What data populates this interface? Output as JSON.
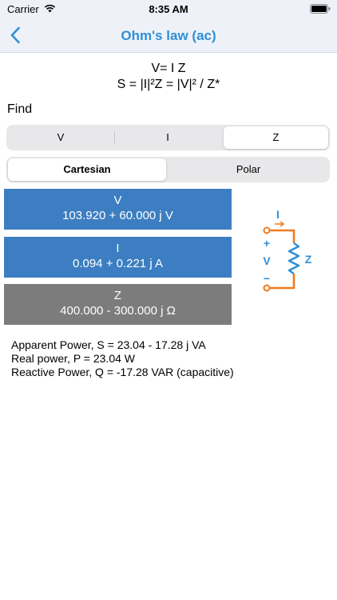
{
  "status_bar": {
    "carrier": "Carrier",
    "time": "8:35 AM"
  },
  "nav": {
    "title": "Ohm's law (ac)"
  },
  "formulas": {
    "line1": "V= I Z",
    "line2": "S = |I|²Z = |V|² / Z*"
  },
  "find": {
    "label": "Find",
    "options": [
      "V",
      "I",
      "Z"
    ],
    "selected": "Z"
  },
  "coordinates": {
    "options": [
      "Cartesian",
      "Polar"
    ],
    "selected": "Cartesian"
  },
  "values": {
    "v": {
      "label": "V",
      "value": "103.920 + 60.000 j V"
    },
    "i": {
      "label": "I",
      "value": "0.094 + 0.221 j A"
    },
    "z": {
      "label": "Z",
      "value": "400.000 - 300.000 j Ω"
    }
  },
  "circuit": {
    "current_label": "I",
    "voltage_label": "V",
    "plus": "+",
    "minus": "−",
    "impedance_label": "Z"
  },
  "power": {
    "apparent": "Apparent Power, S = 23.04 - 17.28 j VA",
    "real": "Real power, P = 23.04 W",
    "reactive": "Reactive Power, Q = -17.28 VAR (capacitive)"
  },
  "colors": {
    "accent": "#2f8fd8",
    "value_box_blue": "#3c7ec1",
    "value_box_gray": "#7c7c7c",
    "circuit_orange": "#f07a1f",
    "circuit_blue": "#2f8fd8"
  }
}
